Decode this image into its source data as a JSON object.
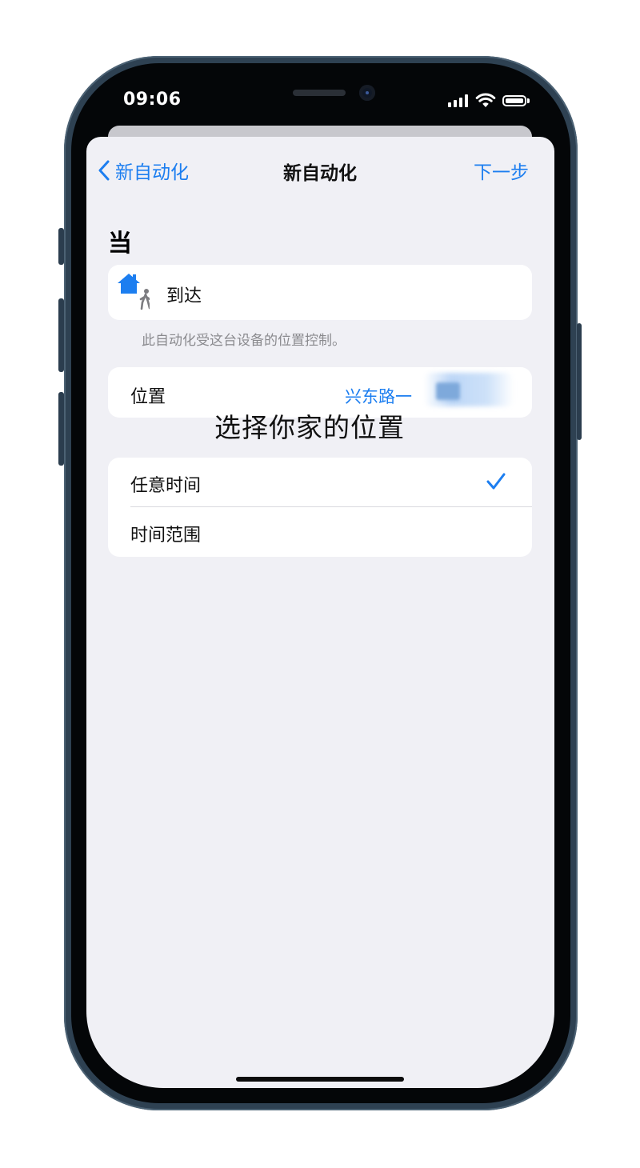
{
  "status_bar": {
    "time": "09:06"
  },
  "nav": {
    "back_label": "新自动化",
    "title": "新自动化",
    "next_label": "下一步"
  },
  "trigger": {
    "section_header": "当",
    "label": "到达",
    "icon": "home-arrive-icon",
    "footer": "此自动化受这台设备的位置控制。"
  },
  "location": {
    "label": "位置",
    "value": "兴东路一"
  },
  "overlay_caption": "选择你家的位置",
  "time_options": [
    {
      "label": "任意时间",
      "selected": true
    },
    {
      "label": "时间范围",
      "selected": false
    }
  ],
  "colors": {
    "accent": "#1c7ef0",
    "background": "#f0f0f5",
    "card": "#ffffff",
    "frame": "#2e4152"
  }
}
